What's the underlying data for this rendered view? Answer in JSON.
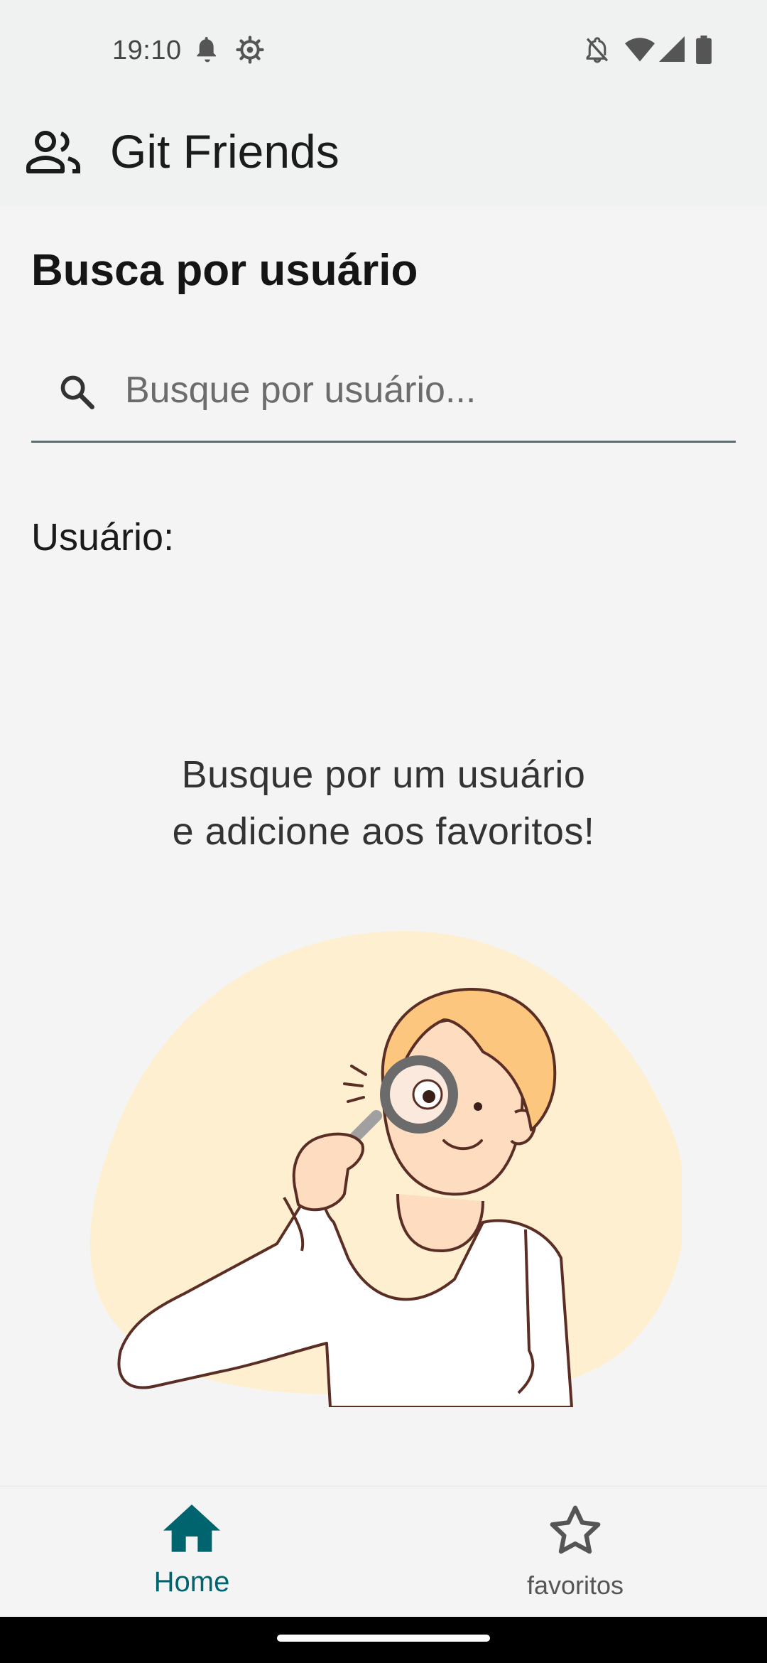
{
  "status_bar": {
    "time": "19:10",
    "icons": [
      "notification-bell-icon",
      "settings-gear-icon",
      "do-not-disturb-icon",
      "wifi-icon",
      "signal-icon",
      "battery-icon"
    ]
  },
  "app_bar": {
    "icon": "people-icon",
    "title": "Git Friends"
  },
  "main": {
    "title": "Busca por usuário",
    "search": {
      "placeholder": "Busque por usuário...",
      "value": "",
      "icon": "search-icon"
    },
    "user_label": "Usuário:",
    "empty_state": {
      "line1": "Busque por um usuário",
      "line2": "e adicione aos favoritos!",
      "illustration": "person-with-magnifying-glass"
    }
  },
  "bottom_nav": {
    "items": [
      {
        "label": "Home",
        "icon": "home-icon",
        "selected": true
      },
      {
        "label": "favoritos",
        "icon": "star-outline-icon",
        "selected": false
      }
    ],
    "active_color": "#00646e",
    "inactive_color": "#555555"
  },
  "colors": {
    "background": "#f4f4f4",
    "app_bar": "#f0f1f1",
    "accent": "#00646e",
    "illustration_blob": "#feefd0"
  }
}
